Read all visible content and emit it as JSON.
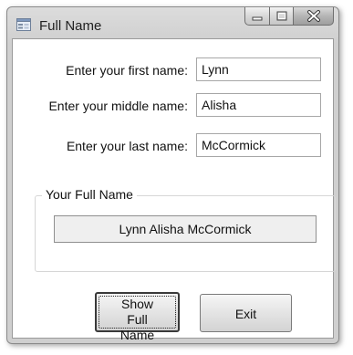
{
  "window": {
    "title": "Full Name",
    "app_icon": "form-icon",
    "controls": [
      "minimize-icon",
      "maximize-icon",
      "close-icon"
    ]
  },
  "form": {
    "first_name_label": "Enter your first name:",
    "first_name_value": "Lynn",
    "middle_name_label": "Enter your middle name:",
    "middle_name_value": "Alisha",
    "last_name_label": "Enter your last name:",
    "last_name_value": "McCormick"
  },
  "group": {
    "title": "Your Full Name",
    "output": "Lynn Alisha McCormick"
  },
  "buttons": {
    "show_full_name": "Show Full Name",
    "exit": "Exit"
  }
}
